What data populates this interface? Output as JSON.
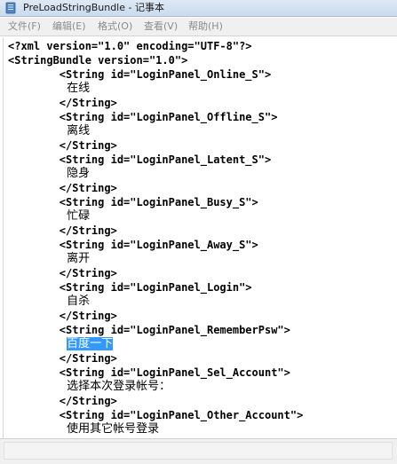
{
  "window": {
    "title": "PreLoadStringBundle - 记事本"
  },
  "menu": {
    "items": [
      {
        "label": "文件(F)"
      },
      {
        "label": "编辑(E)"
      },
      {
        "label": "格式(O)"
      },
      {
        "label": "查看(V)"
      },
      {
        "label": "帮助(H)"
      }
    ]
  },
  "document": {
    "lines": [
      "<?xml version=\"1.0\" encoding=\"UTF-8\"?>",
      "<StringBundle version=\"1.0\">",
      "        <String id=\"LoginPanel_Online_S\">",
      "                在线",
      "        </String>",
      "        <String id=\"LoginPanel_Offline_S\">",
      "                离线",
      "        </String>",
      "        <String id=\"LoginPanel_Latent_S\">",
      "                隐身",
      "        </String>",
      "        <String id=\"LoginPanel_Busy_S\">",
      "                忙碌",
      "        </String>",
      "        <String id=\"LoginPanel_Away_S\">",
      "                离开",
      "        </String>",
      "        <String id=\"LoginPanel_Login\">",
      "                自杀",
      "        </String>",
      "        <String id=\"LoginPanel_RememberPsw\">",
      "                ",
      "        </String>",
      "        <String id=\"LoginPanel_Sel_Account\">",
      "                选择本次登录帐号：",
      "        </String>",
      "        <String id=\"LoginPanel_Other_Account\">",
      "                使用其它帐号登录"
    ],
    "selected_text": "百度一下"
  },
  "colors": {
    "selection": "#3399ff",
    "menu_text_disabled": "#8a8a8a"
  }
}
